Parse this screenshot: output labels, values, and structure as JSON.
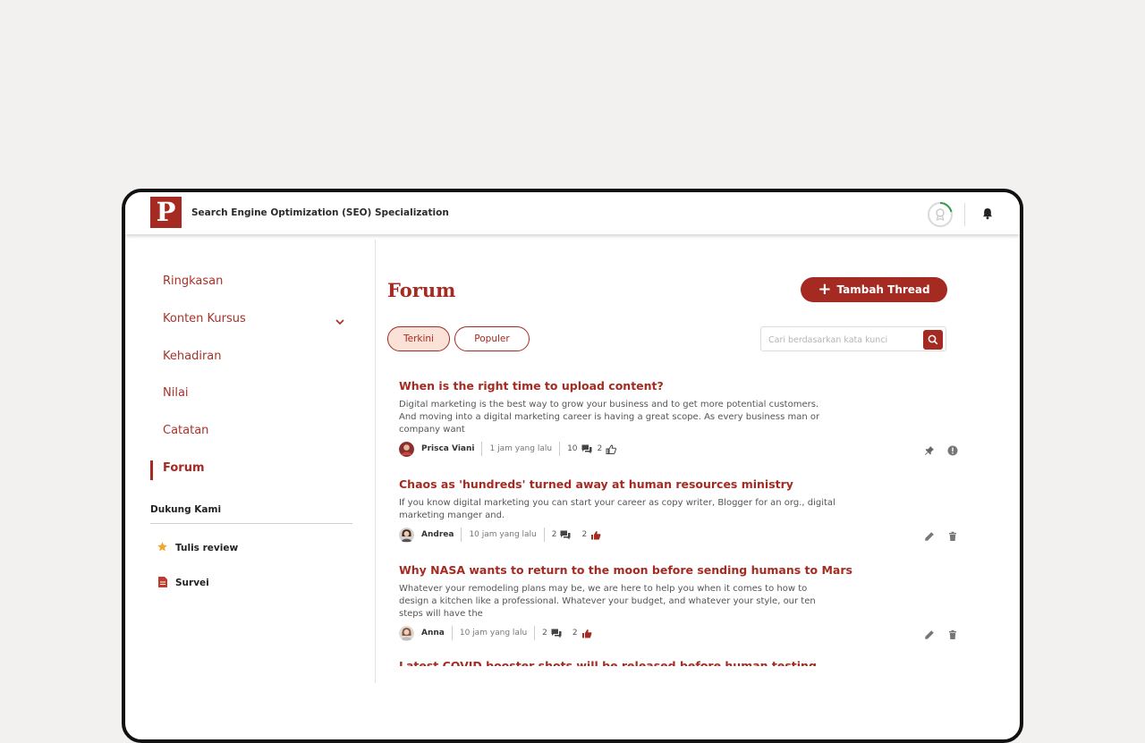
{
  "app": {
    "logo_letter": "P",
    "course_title": "Search Engine Optimization (SEO) Specialization"
  },
  "header": {
    "progress_icon": "badge-progress-icon",
    "notification_icon": "bell-icon"
  },
  "sidebar": {
    "items": [
      {
        "label": "Ringkasan"
      },
      {
        "label": "Konten Kursus"
      },
      {
        "label": "Kehadiran"
      },
      {
        "label": "Nilai"
      },
      {
        "label": "Catatan"
      },
      {
        "label": "Forum"
      }
    ],
    "active_item": "Forum",
    "support": {
      "title": "Dukung Kami",
      "items": [
        {
          "label": "Tulis review",
          "icon": "star-icon"
        },
        {
          "label": "Survei",
          "icon": "document-icon"
        }
      ]
    }
  },
  "main": {
    "page_title": "Forum",
    "add_thread_label": "Tambah Thread",
    "tabs": [
      {
        "label": "Terkini",
        "active": true
      },
      {
        "label": "Populer",
        "active": false
      }
    ],
    "search_placeholder": "Cari berdasarkan kata kunci",
    "threads": [
      {
        "title": "When is the right time to upload content?",
        "excerpt": "Digital marketing is the best way to grow your business and to get more potential customers. And moving into a digital marketing career is having a great scope. As every business man or company want",
        "author": "Prisca Viani",
        "time": "1 jam yang lalu",
        "comments": "10",
        "likes": "2",
        "actions": [
          "pin-icon",
          "report-icon"
        ]
      },
      {
        "title": "Chaos as 'hundreds' turned away at human resources ministry",
        "excerpt": "If you know digital marketing you can start your career as copy writer, Blogger for an org., digital marketing manger and.",
        "author": "Andrea",
        "time": "10 jam yang lalu",
        "comments": "2",
        "likes": "2",
        "actions": [
          "edit-icon",
          "delete-icon"
        ]
      },
      {
        "title": "Why NASA wants to return to the moon before sending humans to Mars",
        "excerpt": "Whatever your remodeling plans may be, we are here to help you when it comes to how to design a kitchen like a professional. Whatever your budget, and whatever your style, our ten steps will have the",
        "author": "Anna",
        "time": "10 jam yang lalu",
        "comments": "2",
        "likes": "2",
        "actions": [
          "edit-icon",
          "delete-icon"
        ]
      }
    ],
    "partial_thread_title": "Latest COVID booster shots will be released before human testing"
  },
  "colors": {
    "brand": "#a52a22",
    "active_tab_bg": "#fbe2d8",
    "progress_green": "#2e9b3e",
    "star": "#f0a832"
  }
}
